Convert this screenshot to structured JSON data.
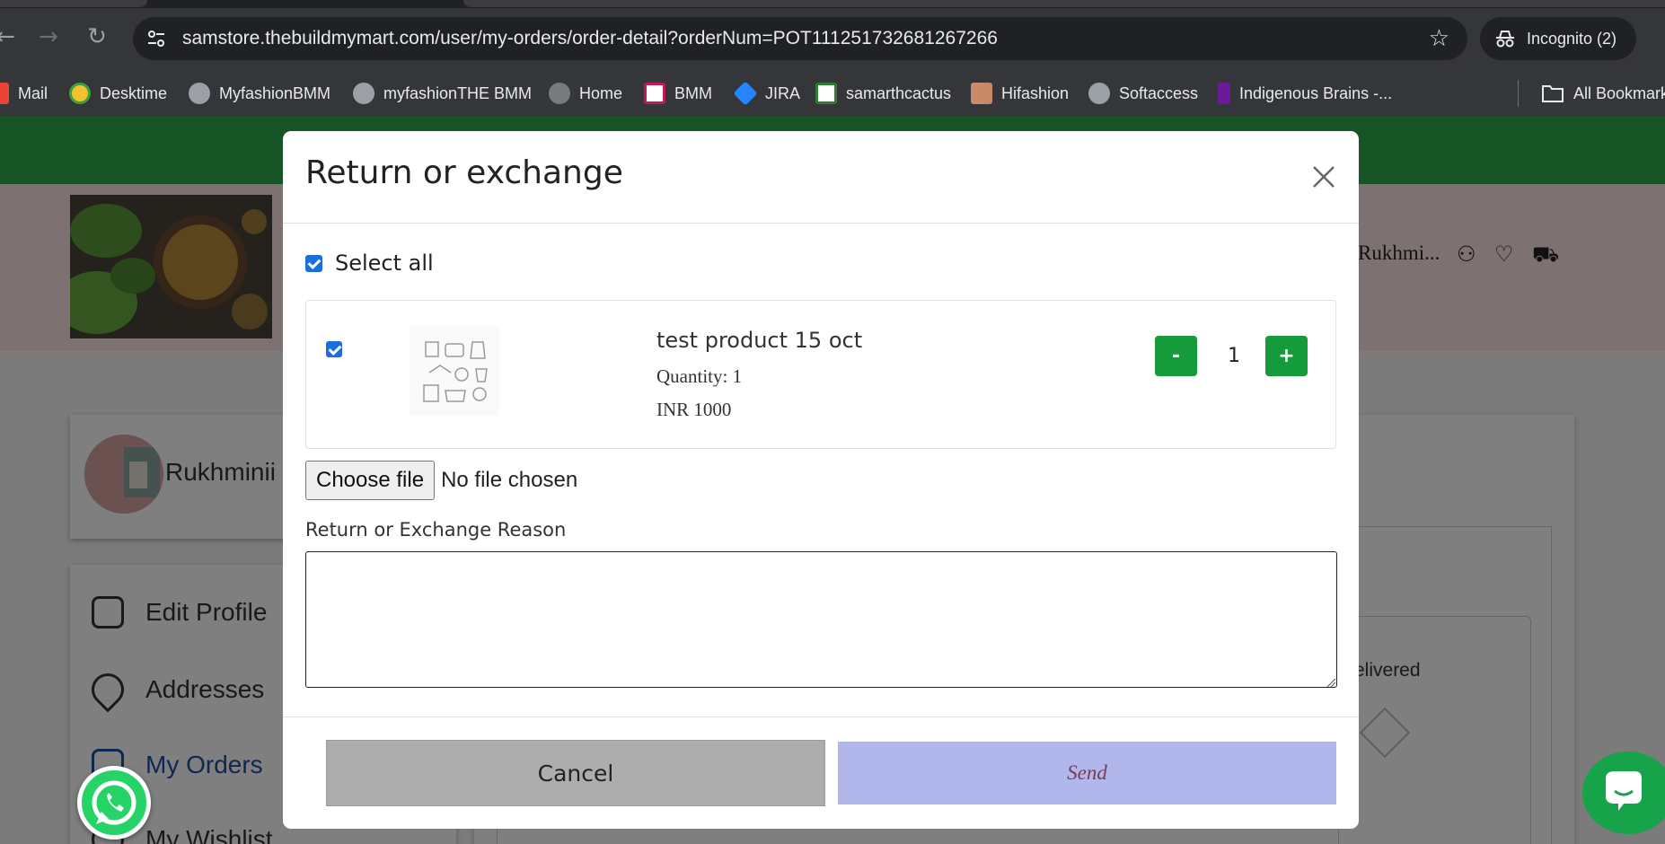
{
  "browser": {
    "url": "samstore.thebuildmymart.com/user/my-orders/order-detail?orderNum=POT111251732681267266",
    "incognito_label": "Incognito (2)",
    "bookmarks": [
      {
        "label": "Mail",
        "icon": "mail-icon",
        "color": "#ea4335"
      },
      {
        "label": "Desktime",
        "icon": "desktime-icon",
        "color": "#3c9e3c"
      },
      {
        "label": "MyfashionBMM",
        "icon": "globe-icon",
        "color": "#9aa0a6"
      },
      {
        "label": "myfashionTHE BMM",
        "icon": "globe-icon",
        "color": "#9aa0a6"
      },
      {
        "label": "Home",
        "icon": "globe-icon",
        "color": "#777b80"
      },
      {
        "label": "BMM",
        "icon": "bmm-icon",
        "color": "#c2185b"
      },
      {
        "label": "JIRA",
        "icon": "jira-icon",
        "color": "#2684ff"
      },
      {
        "label": "samarthcactus",
        "icon": "cactus-icon",
        "color": "#2e7d32"
      },
      {
        "label": "Hifashion",
        "icon": "hifashion-icon",
        "color": "#c98a6a"
      },
      {
        "label": "Softaccess",
        "icon": "globe-icon",
        "color": "#9aa0a6"
      },
      {
        "label": "Indigenous Brains -...",
        "icon": "indigenous-icon",
        "color": "#6a1b9a"
      }
    ],
    "all_bookmarks_label": "All Bookmarks"
  },
  "background_page": {
    "header_user": "Rukhmi...",
    "profile_name": "Rukhminii",
    "menu": [
      {
        "label": "Edit Profile",
        "icon": "user-profile-icon"
      },
      {
        "label": "Addresses",
        "icon": "location-pin-icon"
      },
      {
        "label": "My Orders",
        "icon": "orders-icon"
      },
      {
        "label": "My Wishlist",
        "icon": "heart-icon"
      }
    ],
    "status_text": "elivered"
  },
  "modal": {
    "title": "Return or exchange",
    "select_all_label": "Select all",
    "product": {
      "name": "test product 15 oct",
      "quantity_text": "Quantity: 1",
      "price_text": "INR 1000",
      "stepper_value": "1",
      "minus_label": "-",
      "plus_label": "+"
    },
    "file": {
      "button_label": "Choose file",
      "status": "No file chosen"
    },
    "reason_label": "Return or Exchange Reason",
    "reason_value": "",
    "cancel_label": "Cancel",
    "send_label": "Send"
  },
  "colors": {
    "accent_green": "#159a3c",
    "checkbox_blue": "#1a6fe0",
    "send_bg": "#b2b7eb"
  }
}
